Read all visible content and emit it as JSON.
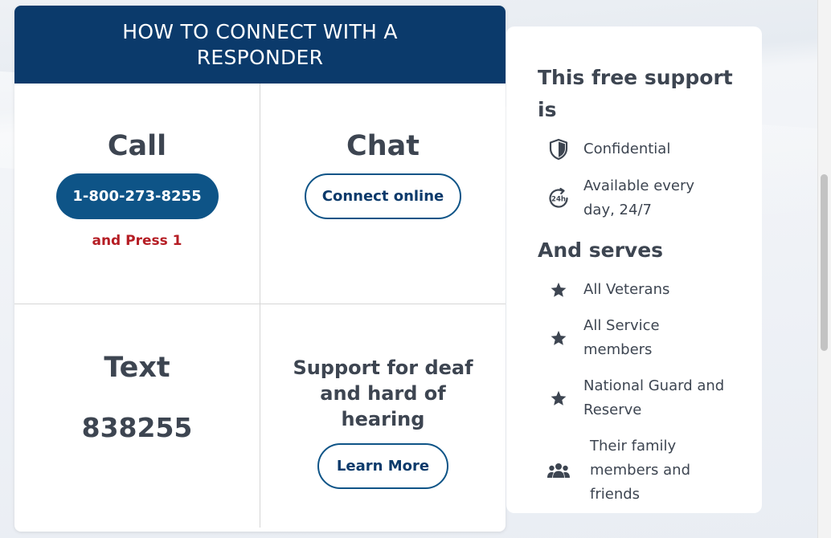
{
  "connect": {
    "header": "HOW TO CONNECT WITH A RESPONDER",
    "call": {
      "title": "Call",
      "phone_button": "1-800-273-8255",
      "note": "and Press 1"
    },
    "chat": {
      "title": "Chat",
      "button": "Connect online"
    },
    "text": {
      "title": "Text",
      "number": "838255"
    },
    "deaf": {
      "title": "Support for deaf and hard of hearing",
      "button": "Learn More"
    }
  },
  "support": {
    "heading_free": "This free support is",
    "free_items": [
      {
        "icon": "shield-icon",
        "label": "Confidential"
      },
      {
        "icon": "24h-clock-icon",
        "label": "Available every day, 24/7"
      }
    ],
    "heading_serves": "And serves",
    "serves_items": [
      {
        "icon": "star-icon",
        "label": "All Veterans"
      },
      {
        "icon": "star-icon",
        "label": "All Service members"
      },
      {
        "icon": "star-icon",
        "label": "National Guard and Reserve"
      },
      {
        "icon": "people-icon",
        "label": "Their family members and friends"
      }
    ]
  },
  "colors": {
    "header_navy": "#0b3a6b",
    "button_blue": "#0e5487",
    "alert_red": "#b51d24",
    "text_gray": "#3d4551"
  }
}
